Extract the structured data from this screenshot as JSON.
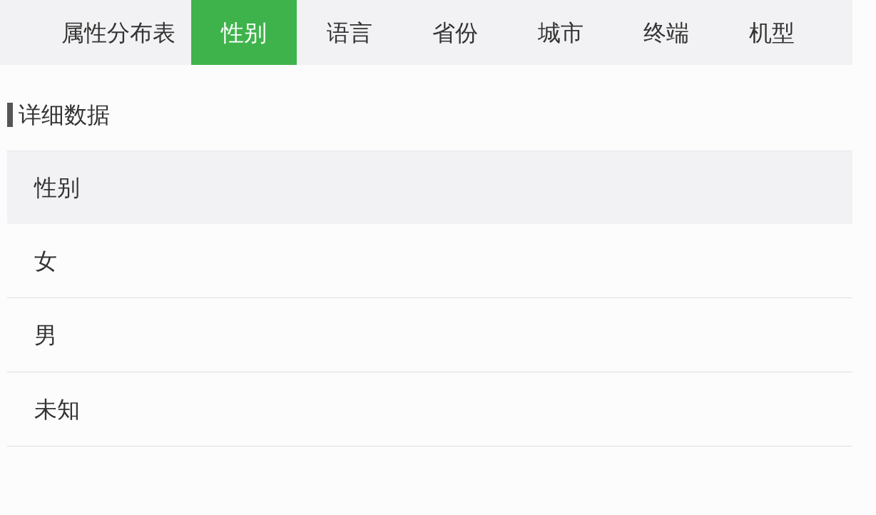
{
  "tabs": [
    {
      "label": "属性分布表",
      "selected": false
    },
    {
      "label": "性别",
      "selected": true
    },
    {
      "label": "语言",
      "selected": false
    },
    {
      "label": "省份",
      "selected": false
    },
    {
      "label": "城市",
      "selected": false
    },
    {
      "label": "终端",
      "selected": false
    },
    {
      "label": "机型",
      "selected": false
    }
  ],
  "section_title": "详细数据",
  "table": {
    "columns": [
      "性别"
    ],
    "rows": [
      [
        "女"
      ],
      [
        "男"
      ],
      [
        "未知"
      ]
    ]
  }
}
